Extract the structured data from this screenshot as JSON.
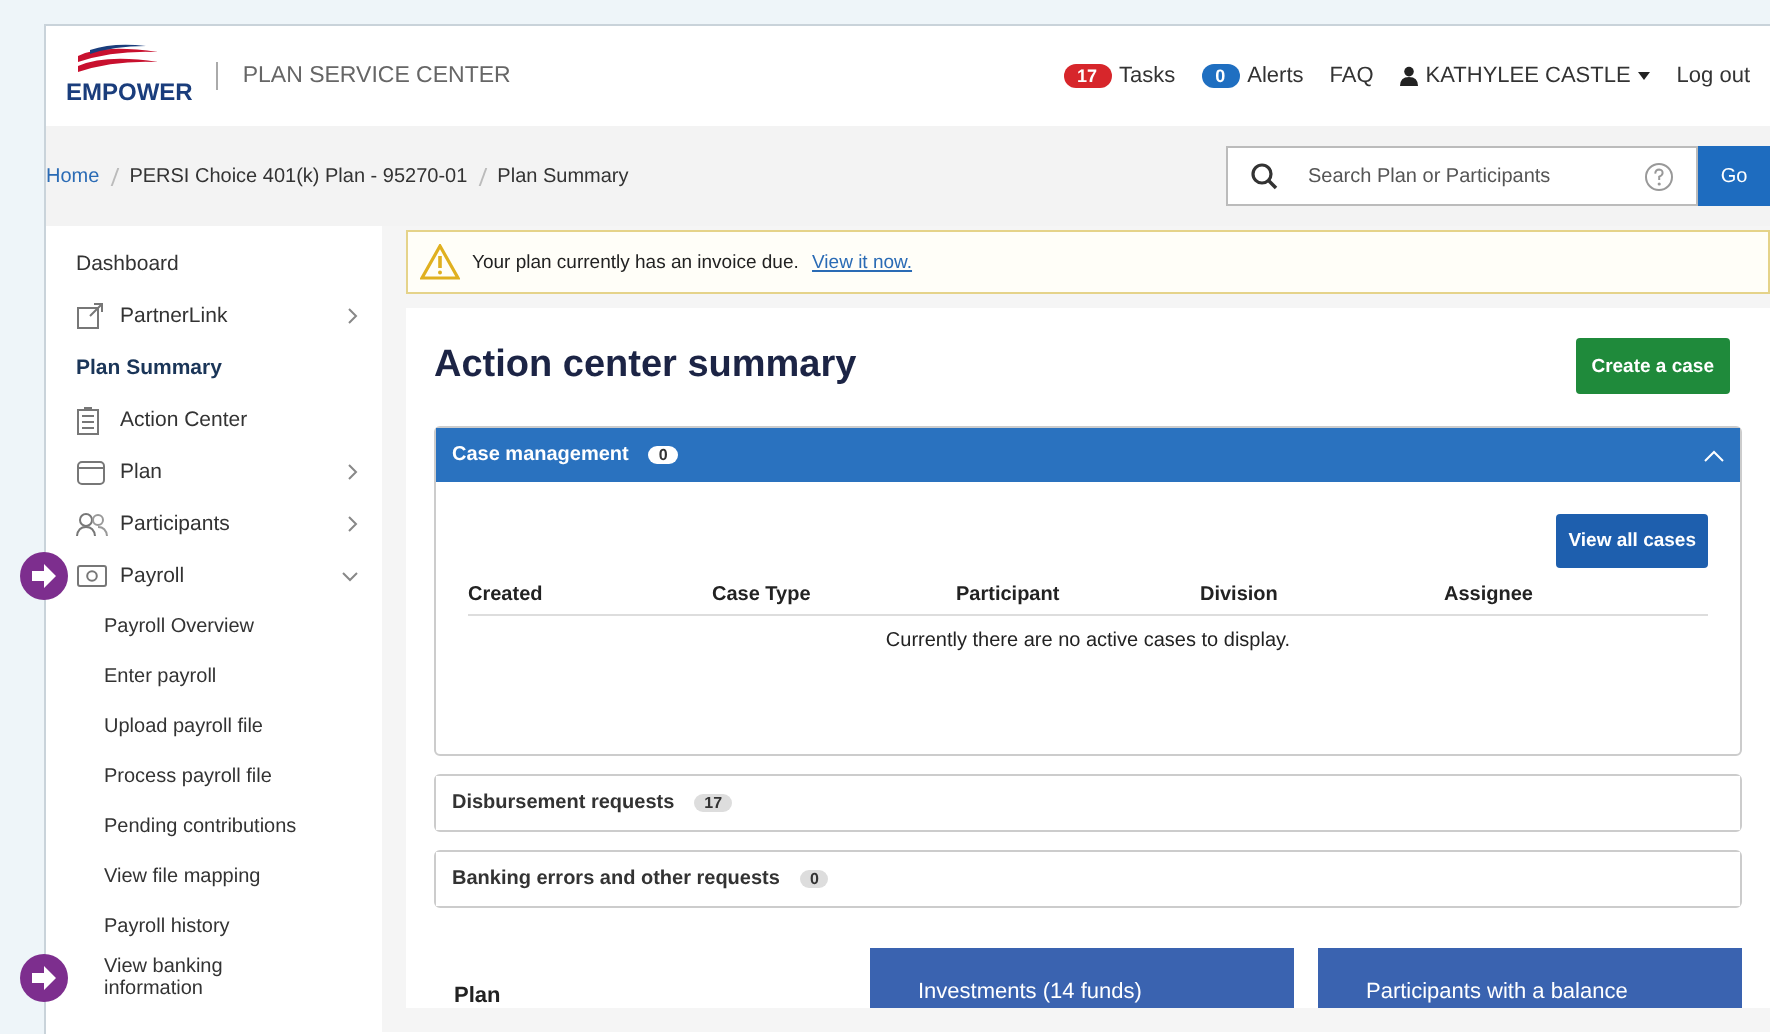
{
  "header": {
    "brand": "EMPOWER",
    "title": "PLAN SERVICE CENTER",
    "nav": [
      {
        "kind": "badge",
        "count": "17",
        "label": "Tasks",
        "color": "#d7262b"
      },
      {
        "kind": "badge",
        "count": "0",
        "label": "Alerts",
        "color": "#1f6fc1"
      },
      {
        "kind": "link",
        "label": "FAQ"
      },
      {
        "kind": "user",
        "label": "KATHYLEE CASTLE"
      },
      {
        "kind": "link",
        "label": "Log out"
      }
    ]
  },
  "breadcrumb": [
    {
      "label": "Home",
      "link": true
    },
    {
      "label": "PERSI Choice 401(k) Plan - 95270-01",
      "link": false
    },
    {
      "label": "Plan Summary",
      "link": false
    }
  ],
  "search": {
    "placeholder": "Search Plan or Participants",
    "button": "Go"
  },
  "sidebar": {
    "items": [
      {
        "kind": "plain",
        "label": "Dashboard",
        "marked": false
      },
      {
        "kind": "icon",
        "label": "PartnerLink",
        "marked": false,
        "expanded": false
      },
      {
        "kind": "heading",
        "label": "Plan Summary",
        "marked": false
      },
      {
        "kind": "icon",
        "label": "Action Center",
        "marked": false
      },
      {
        "kind": "icon",
        "label": "Plan",
        "marked": false,
        "expanded": false
      },
      {
        "kind": "icon",
        "label": "Participants",
        "marked": false,
        "expanded": false
      },
      {
        "kind": "icon",
        "label": "Payroll",
        "marked": true,
        "expanded": true,
        "children": [
          {
            "label": "Payroll Overview",
            "marked": false
          },
          {
            "label": "Enter payroll",
            "marked": false
          },
          {
            "label": "Upload payroll file",
            "marked": false
          },
          {
            "label": "Process payroll file",
            "marked": false
          },
          {
            "label": "Pending contributions",
            "marked": false
          },
          {
            "label": "View file mapping",
            "marked": false
          },
          {
            "label": "Payroll history",
            "marked": false
          },
          {
            "label": "View banking information",
            "marked": true
          }
        ]
      }
    ]
  },
  "alert": {
    "text": "Your plan currently has an invoice due.",
    "link": "View it now."
  },
  "title": "Action center summary",
  "create_button": "Create a case",
  "panels": [
    {
      "title": "Case management",
      "count": "0",
      "expanded": true,
      "button": "View all cases",
      "columns": [
        "Created",
        "Case Type",
        "Participant",
        "Division",
        "Assignee"
      ],
      "empty": "Currently there are no active cases to display."
    },
    {
      "title": "Disbursement requests",
      "count": "17",
      "expanded": false
    },
    {
      "title": "Banking errors and other requests",
      "count": "0",
      "expanded": false
    }
  ],
  "plan": {
    "label": "Plan",
    "cards": [
      "Investments (14 funds)",
      "Participants with a balance"
    ]
  }
}
